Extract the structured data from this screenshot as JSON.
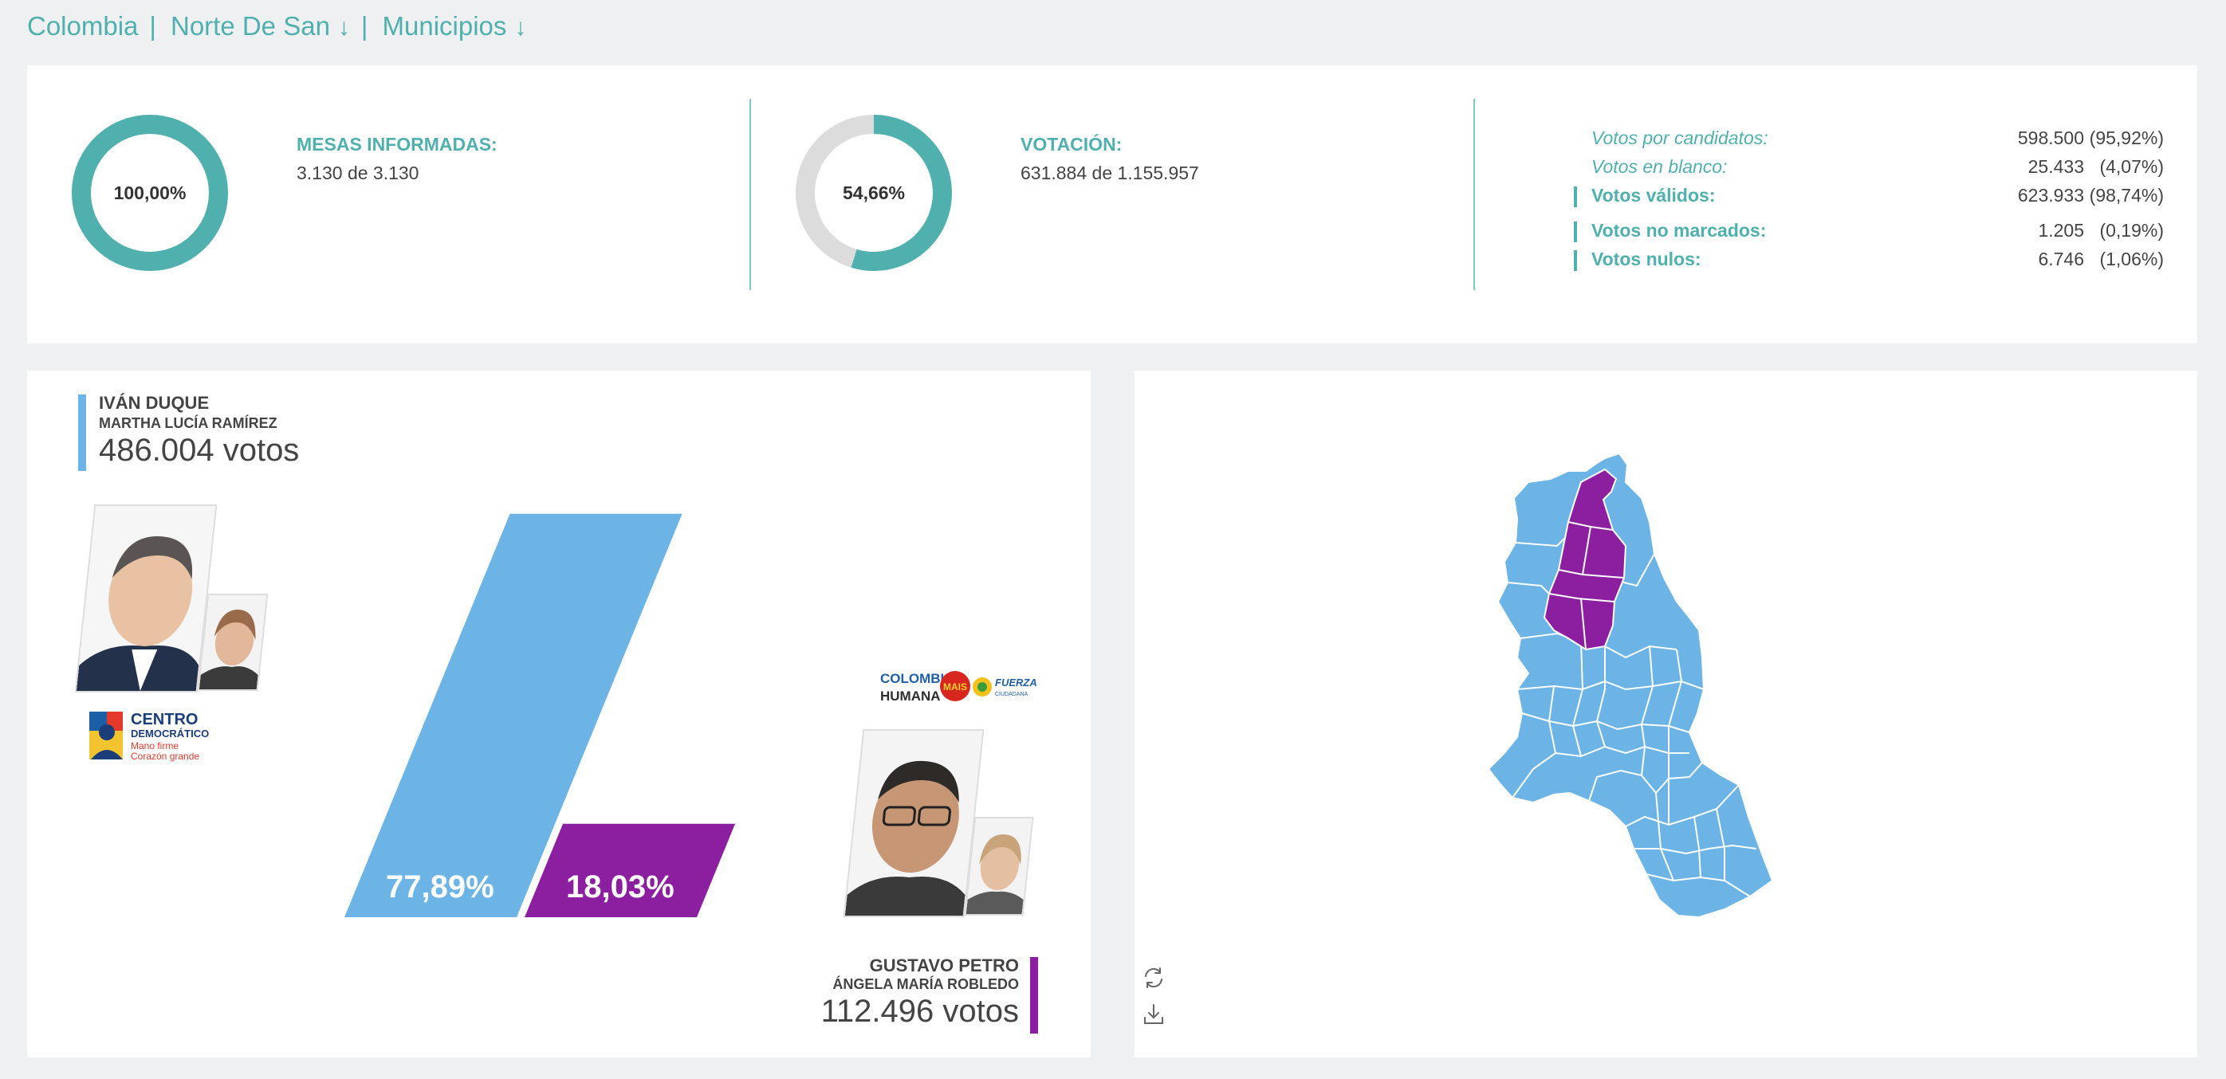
{
  "breadcrumb": {
    "country": "Colombia",
    "department": "Norte De San",
    "level": "Municipios",
    "arrow": "↓",
    "separator": "|"
  },
  "summary": {
    "mesas": {
      "percent_label": "100,00%",
      "percent": 100.0,
      "title": "MESAS INFORMADAS:",
      "value": "3.130 de 3.130"
    },
    "votacion": {
      "percent_label": "54,66%",
      "percent": 54.66,
      "title": "VOTACIÓN:",
      "value": "631.884 de 1.155.957"
    },
    "breakdown": [
      {
        "label": "Votos por candidatos:",
        "value": "598.500",
        "percent": "(95,92%)",
        "style": "italic"
      },
      {
        "label": "Votos en blanco:",
        "value": "25.433",
        "percent": "(4,07%)",
        "style": "italic"
      },
      {
        "label": "Votos válidos:",
        "value": "623.933",
        "percent": "(98,74%)",
        "style": "bold"
      },
      {
        "label": "Votos no marcados:",
        "value": "1.205",
        "percent": "(0,19%)",
        "style": "bold"
      },
      {
        "label": "Votos nulos:",
        "value": "6.746",
        "percent": "(1,06%)",
        "style": "bold"
      }
    ]
  },
  "candidates": [
    {
      "name": "IVÁN DUQUE",
      "vp": "MARTHA LUCÍA RAMÍREZ",
      "votes": "486.004 votos",
      "percent_label": "77,89%",
      "percent": 77.89,
      "color": "#6cb4e6",
      "party": {
        "line1": "CENTRO",
        "line2": "DEMOCRÁTICO",
        "line3": "Mano firme",
        "line4": "Corazón grande"
      }
    },
    {
      "name": "GUSTAVO PETRO",
      "vp": "ÁNGELA MARÍA ROBLEDO",
      "votes": "112.496 votos",
      "percent_label": "18,03%",
      "percent": 18.03,
      "color": "#8b1fa0",
      "party": {
        "line1a": "COLOMBIA",
        "line1b": "HUMANA",
        "mais": "MAIS",
        "fuerza": "FUERZA",
        "ciudadana": "CIUDADANA"
      }
    }
  ],
  "map": {
    "colors": {
      "winner_duque": "#6cb4e6",
      "winner_petro": "#8b1fa0"
    },
    "tools": [
      "refresh-icon",
      "download-icon"
    ]
  }
}
